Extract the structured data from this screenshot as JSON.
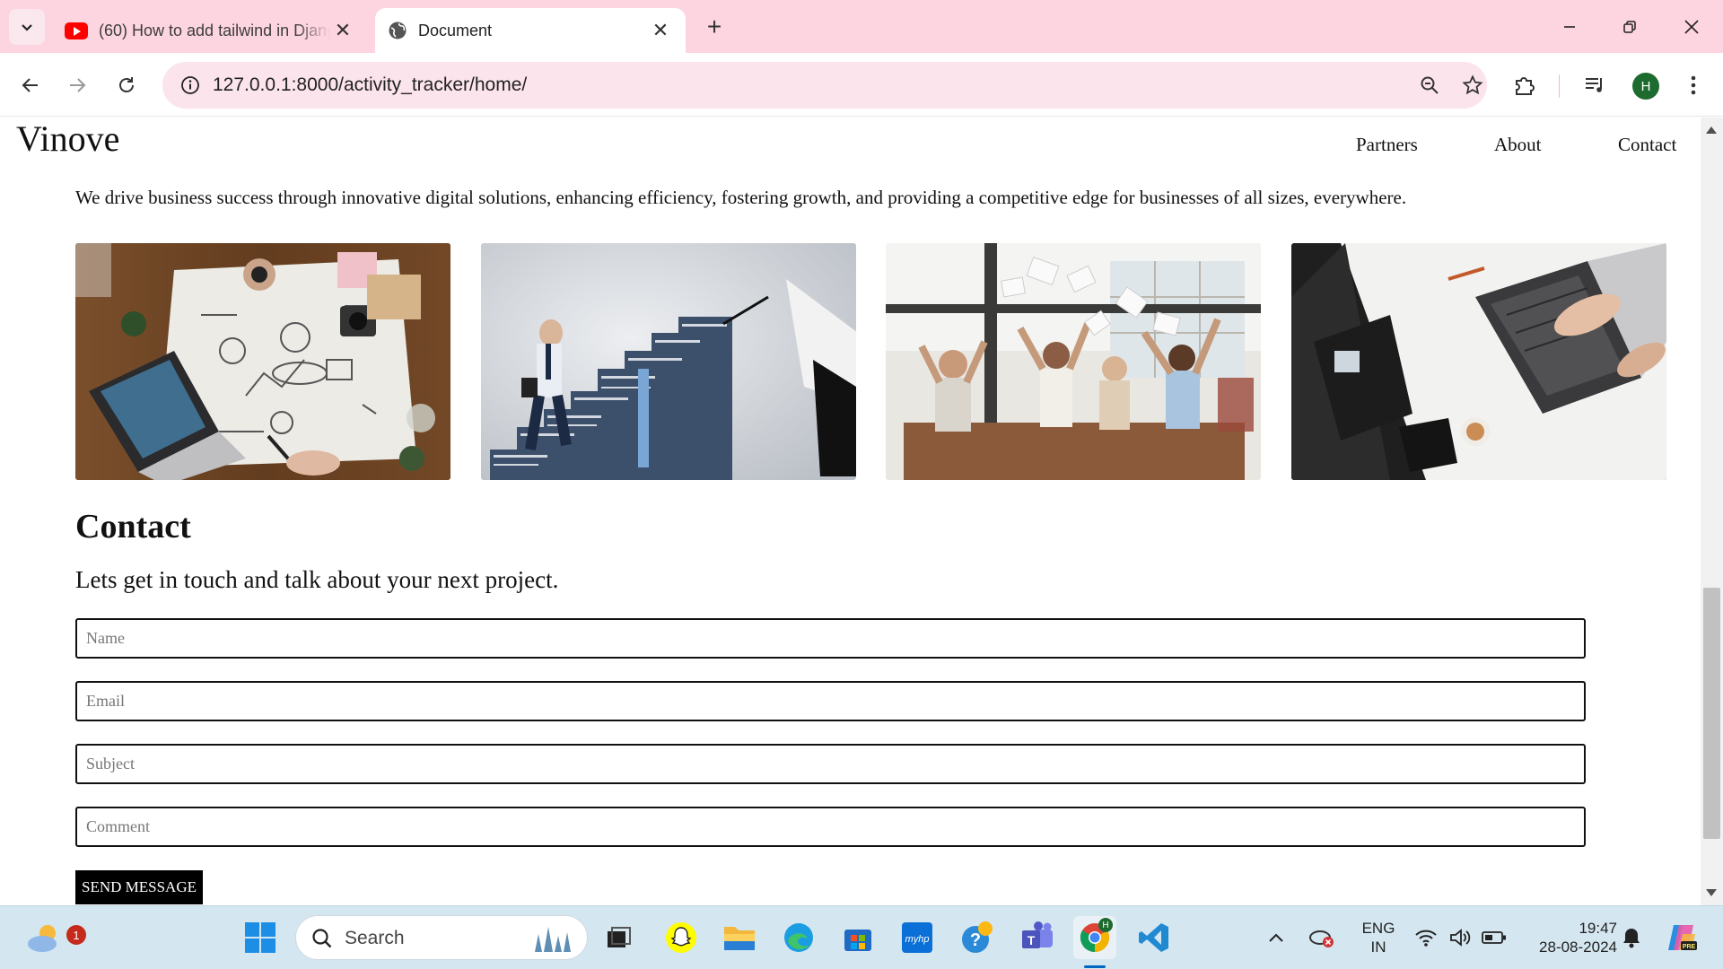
{
  "browser": {
    "tabs": [
      {
        "title": "(60) How to add tailwind in Django",
        "active": false,
        "icon": "youtube-icon"
      },
      {
        "title": "Document",
        "active": true,
        "icon": "globe-icon"
      }
    ],
    "url": "127.0.0.1:8000/activity_tracker/home/",
    "profile_initial": "H"
  },
  "page": {
    "brand": "Vinove",
    "nav": [
      "Partners",
      "About",
      "Contact"
    ],
    "tagline": "We drive business success through innovative digital solutions, enhancing efficiency, fostering growth, and providing a competitive edge for businesses of all sizes, everywhere.",
    "photos": [
      {
        "name": "photo-business-plan-desk",
        "subject": "desk with laptop and business sketches"
      },
      {
        "name": "photo-success-staircase",
        "subject": "businessman climbing word staircase"
      },
      {
        "name": "photo-team-celebration",
        "subject": "team throwing papers in office"
      },
      {
        "name": "photo-laptop-work",
        "subject": "hands typing on laptop at white desk"
      }
    ],
    "contact": {
      "title": "Contact",
      "subtitle": "Lets get in touch and talk about your next project.",
      "fields": {
        "name": {
          "placeholder": "Name",
          "value": ""
        },
        "email": {
          "placeholder": "Email",
          "value": ""
        },
        "subject": {
          "placeholder": "Subject",
          "value": ""
        },
        "comment": {
          "placeholder": "Comment",
          "value": ""
        }
      },
      "submit_label": "SEND MESSAGE"
    }
  },
  "taskbar": {
    "weather_badge": "1",
    "search_placeholder": "Search",
    "language": "ENG",
    "region": "IN",
    "time": "19:47",
    "date": "28-08-2024"
  },
  "colors": {
    "tabstrip": "#fdd5e0",
    "omnibox": "#fce4ec",
    "taskbar": "#d4e6f0",
    "button": "#000000"
  }
}
